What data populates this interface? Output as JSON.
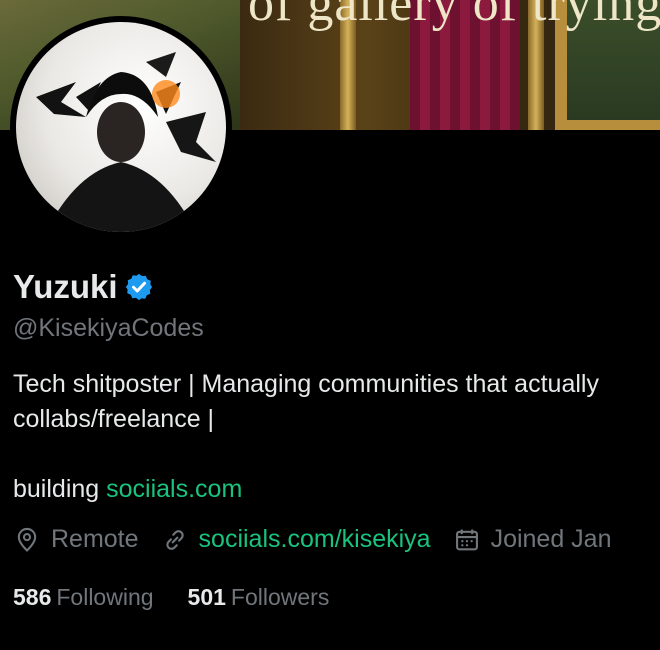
{
  "banner": {
    "text": "of gallery of trying"
  },
  "profile": {
    "name": "Yuzuki",
    "handle": "@KisekiyaCodes",
    "bio_line1": "Tech shitposter | Managing communities that actually",
    "bio_line2": "collabs/freelance |",
    "bio_line3_prefix": "building ",
    "bio_link": "sociials.com",
    "location": "Remote",
    "website": "sociials.com/kisekiya",
    "joined": "Joined Jan",
    "following_count": "586",
    "following_label": "Following",
    "followers_count": "501",
    "followers_label": "Followers"
  },
  "icons": {
    "verified": "verified-badge-icon",
    "location": "location-pin-icon",
    "link": "link-icon",
    "calendar": "calendar-icon"
  },
  "colors": {
    "accent_green": "#19c37d",
    "verified_blue": "#1d9bf0",
    "muted": "#71767b"
  }
}
